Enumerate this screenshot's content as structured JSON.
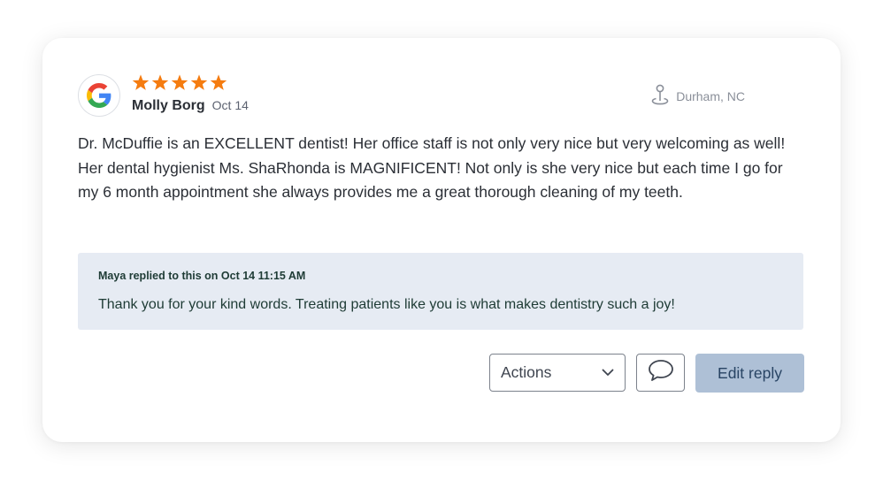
{
  "review": {
    "source_icon": "google-logo-icon",
    "rating": 5,
    "reviewer_name": "Molly Borg",
    "date": "Oct 14",
    "location": "Durham, NC",
    "location_icon": "map-pin-icon",
    "text": "Dr. McDuffie is an EXCELLENT dentist! Her office staff is not only very nice but very welcoming as well!  Her dental hygienist Ms. ShaRhonda is MAGNIFICENT! Not only is she very nice but each time I go for my 6 month appointment she always provides me a great thorough cleaning of my teeth."
  },
  "reply": {
    "meta": "Maya replied to this on Oct 14 11:15 AM",
    "text": "Thank you for your kind words. Treating patients like you is what makes dentistry such a joy!"
  },
  "footer": {
    "actions_label": "Actions",
    "comment_icon": "speech-bubble-icon",
    "edit_reply_label": "Edit reply"
  },
  "colors": {
    "star": "#f57c10",
    "reply_bg": "#e6ebf3",
    "edit_button_bg": "#aec0d6",
    "edit_button_text": "#284464"
  }
}
